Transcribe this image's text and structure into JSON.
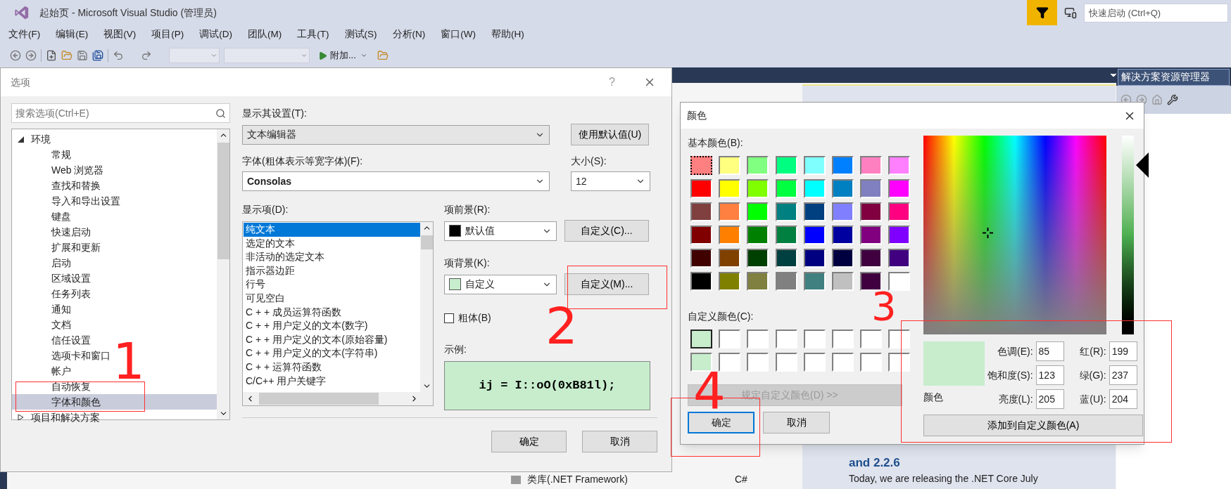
{
  "window": {
    "title": "起始页 - Microsoft Visual Studio (管理员)"
  },
  "quick_launch": {
    "placeholder": "快速启动 (Ctrl+Q)"
  },
  "menu": [
    "文件(F)",
    "编辑(E)",
    "视图(V)",
    "项目(P)",
    "调试(D)",
    "团队(M)",
    "工具(T)",
    "测试(S)",
    "分析(N)",
    "窗口(W)",
    "帮助(H)"
  ],
  "toolbar": {
    "attach_button": "附加..."
  },
  "start_page": {
    "project_item": "类库(.NET Framework)",
    "language": "C#",
    "news_title": "and 2.2.6",
    "news_text": "Today, we are releasing the .NET Core July"
  },
  "solution_explorer": {
    "title": "解决方案资源管理器"
  },
  "options_dialog": {
    "title": "选项",
    "help": "?",
    "search": {
      "placeholder": "搜索选项(Ctrl+E)"
    },
    "tree": [
      {
        "label": "环境",
        "expanded": true,
        "selected": false,
        "children": [
          {
            "label": "常规",
            "selected": false
          },
          {
            "label": "Web 浏览器",
            "selected": false
          },
          {
            "label": "查找和替换",
            "selected": false
          },
          {
            "label": "导入和导出设置",
            "selected": false
          },
          {
            "label": "键盘",
            "selected": false
          },
          {
            "label": "快速启动",
            "selected": false
          },
          {
            "label": "扩展和更新",
            "selected": false
          },
          {
            "label": "启动",
            "selected": false
          },
          {
            "label": "区域设置",
            "selected": false
          },
          {
            "label": "任务列表",
            "selected": false
          },
          {
            "label": "通知",
            "selected": false
          },
          {
            "label": "文档",
            "selected": false
          },
          {
            "label": "信任设置",
            "selected": false
          },
          {
            "label": "选项卡和窗口",
            "selected": false
          },
          {
            "label": "帐户",
            "selected": false
          },
          {
            "label": "自动恢复",
            "selected": false
          },
          {
            "label": "字体和颜色",
            "selected": true
          }
        ]
      },
      {
        "label": "项目和解决方案",
        "expanded": false,
        "selected": false
      }
    ],
    "show_settings_label": "显示其设置(T):",
    "show_settings_value": "文本编辑器",
    "use_defaults_button": "使用默认值(U)",
    "font_label": "字体(粗体表示等宽字体)(F):",
    "font_value": "Consolas",
    "size_label": "大小(S):",
    "size_value": "12",
    "display_items_label": "显示项(D):",
    "display_items": [
      {
        "label": "纯文本",
        "selected": true
      },
      {
        "label": "选定的文本",
        "selected": false
      },
      {
        "label": "非活动的选定文本",
        "selected": false
      },
      {
        "label": "指示器边距",
        "selected": false
      },
      {
        "label": "行号",
        "selected": false
      },
      {
        "label": "可见空白",
        "selected": false
      },
      {
        "label": "C + + 成员运算符函数",
        "selected": false
      },
      {
        "label": "C + + 用户定义的文本(数字)",
        "selected": false
      },
      {
        "label": "C + + 用户定义的文本(原始容量)",
        "selected": false
      },
      {
        "label": "C + + 用户定义的文本(字符串)",
        "selected": false
      },
      {
        "label": "C + + 运算符函数",
        "selected": false
      },
      {
        "label": "C/C++ 用户关键字",
        "selected": false
      }
    ],
    "foreground_label": "项前景(R):",
    "foreground_value": "默认值",
    "foreground_button": "自定义(C)...",
    "background_label": "项背景(K):",
    "background_value": "自定义",
    "background_button": "自定义(M)...",
    "bold": {
      "label": "粗体(B)",
      "checked": false
    },
    "sample_label": "示例:",
    "sample_text": "ij = I::oO(0xB81l);",
    "ok_button": "确定",
    "cancel_button": "取消"
  },
  "color_dialog": {
    "title": "颜色",
    "basic_label": "基本颜色(B):",
    "basic_colors": [
      {
        "color": "#ff8080",
        "selected": true
      },
      {
        "color": "#ffff80",
        "selected": false
      },
      {
        "color": "#80ff80",
        "selected": false
      },
      {
        "color": "#00ff80",
        "selected": false
      },
      {
        "color": "#80ffff",
        "selected": false
      },
      {
        "color": "#0080ff",
        "selected": false
      },
      {
        "color": "#ff80c0",
        "selected": false
      },
      {
        "color": "#ff80ff",
        "selected": false
      },
      {
        "color": "#ff0000",
        "selected": false
      },
      {
        "color": "#ffff00",
        "selected": false
      },
      {
        "color": "#80ff00",
        "selected": false
      },
      {
        "color": "#00ff40",
        "selected": false
      },
      {
        "color": "#00ffff",
        "selected": false
      },
      {
        "color": "#0080c0",
        "selected": false
      },
      {
        "color": "#8080c0",
        "selected": false
      },
      {
        "color": "#ff00ff",
        "selected": false
      },
      {
        "color": "#804040",
        "selected": false
      },
      {
        "color": "#ff8040",
        "selected": false
      },
      {
        "color": "#00ff00",
        "selected": false
      },
      {
        "color": "#008080",
        "selected": false
      },
      {
        "color": "#004080",
        "selected": false
      },
      {
        "color": "#8080ff",
        "selected": false
      },
      {
        "color": "#800040",
        "selected": false
      },
      {
        "color": "#ff0080",
        "selected": false
      },
      {
        "color": "#800000",
        "selected": false
      },
      {
        "color": "#ff8000",
        "selected": false
      },
      {
        "color": "#008000",
        "selected": false
      },
      {
        "color": "#008040",
        "selected": false
      },
      {
        "color": "#0000ff",
        "selected": false
      },
      {
        "color": "#0000a0",
        "selected": false
      },
      {
        "color": "#800080",
        "selected": false
      },
      {
        "color": "#8000ff",
        "selected": false
      },
      {
        "color": "#400000",
        "selected": false
      },
      {
        "color": "#804000",
        "selected": false
      },
      {
        "color": "#004000",
        "selected": false
      },
      {
        "color": "#004040",
        "selected": false
      },
      {
        "color": "#000080",
        "selected": false
      },
      {
        "color": "#000040",
        "selected": false
      },
      {
        "color": "#400040",
        "selected": false
      },
      {
        "color": "#400080",
        "selected": false
      },
      {
        "color": "#000000",
        "selected": false
      },
      {
        "color": "#808000",
        "selected": false
      },
      {
        "color": "#808040",
        "selected": false
      },
      {
        "color": "#808080",
        "selected": false
      },
      {
        "color": "#408080",
        "selected": false
      },
      {
        "color": "#c0c0c0",
        "selected": false
      },
      {
        "color": "#400040",
        "selected": false
      },
      {
        "color": "#ffffff",
        "selected": false
      }
    ],
    "custom_label": "自定义颜色(C):",
    "custom_colors": [
      {
        "color": "#c7edcc",
        "selected": true
      },
      {
        "color": "#ffffff",
        "selected": false
      },
      {
        "color": "#ffffff",
        "selected": false
      },
      {
        "color": "#ffffff",
        "selected": false
      },
      {
        "color": "#ffffff",
        "selected": false
      },
      {
        "color": "#ffffff",
        "selected": false
      },
      {
        "color": "#ffffff",
        "selected": false
      },
      {
        "color": "#ffffff",
        "selected": false
      },
      {
        "color": "#c7edcc",
        "selected": false
      },
      {
        "color": "#ffffff",
        "selected": false
      },
      {
        "color": "#ffffff",
        "selected": false
      },
      {
        "color": "#ffffff",
        "selected": false
      },
      {
        "color": "#ffffff",
        "selected": false
      },
      {
        "color": "#ffffff",
        "selected": false
      },
      {
        "color": "#ffffff",
        "selected": false
      },
      {
        "color": "#ffffff",
        "selected": false
      }
    ],
    "define_button": {
      "label": "规定自定义颜色(D) >>",
      "disabled": true
    },
    "ok_button": "确定",
    "cancel_button": "取消",
    "luminance": {
      "level": 0.85
    },
    "preview_label": "颜色",
    "fields": [
      {
        "label": "色调(E):",
        "value": "85"
      },
      {
        "label": "红(R):",
        "value": "199"
      },
      {
        "label": "饱和度(S):",
        "value": "123"
      },
      {
        "label": "绿(G):",
        "value": "237"
      },
      {
        "label": "亮度(L):",
        "value": "205"
      },
      {
        "label": "蓝(U):",
        "value": "204"
      }
    ],
    "add_button": "添加到自定义颜色(A)"
  },
  "annotations": [
    {
      "text": "1"
    },
    {
      "text": "2"
    },
    {
      "text": "3"
    },
    {
      "text": "4"
    }
  ]
}
